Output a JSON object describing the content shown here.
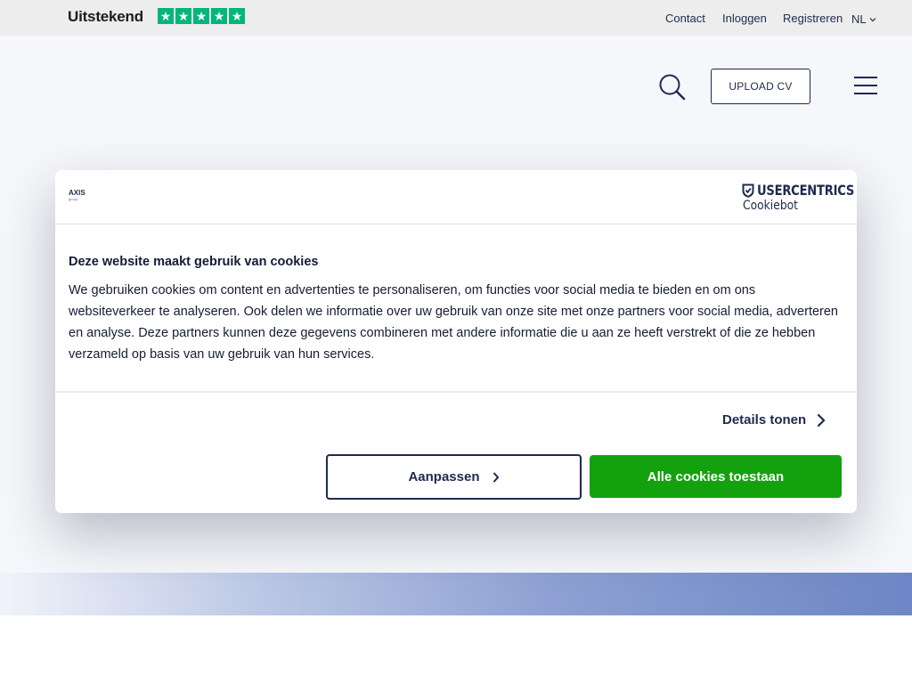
{
  "topbar": {
    "trustpilot_label": "Uitstekend",
    "trustpilot_stars": 5,
    "links": {
      "contact": "Contact",
      "login": "Inloggen",
      "register": "Registreren"
    },
    "language": "NL",
    "star_color": "#00b67a"
  },
  "header": {
    "upload_label": "UPLOAD CV",
    "search_icon": "search-icon",
    "menu_icon": "hamburger-menu-icon"
  },
  "cookie_dialog": {
    "brand_logo": {
      "name": "AXIS",
      "sub": "group"
    },
    "provider": {
      "name": "USERCENTRICS",
      "sub": "Cookiebot"
    },
    "title": "Deze website maakt gebruik van cookies",
    "body": "We gebruiken cookies om content en advertenties te personaliseren, om functies voor social media te bieden en om ons websiteverkeer te analyseren. Ook delen we informatie over uw gebruik van onze site met onze partners voor social media, adverteren en analyse. Deze partners kunnen deze gegevens combineren met andere informatie die u aan ze heeft verstrekt of die ze hebben verzameld op basis van uw gebruik van hun services.",
    "details_label": "Details tonen",
    "customize_label": "Aanpassen",
    "allow_all_label": "Alle cookies toestaan",
    "accent_color": "#13a10e",
    "text_color": "#1f2a4d"
  }
}
